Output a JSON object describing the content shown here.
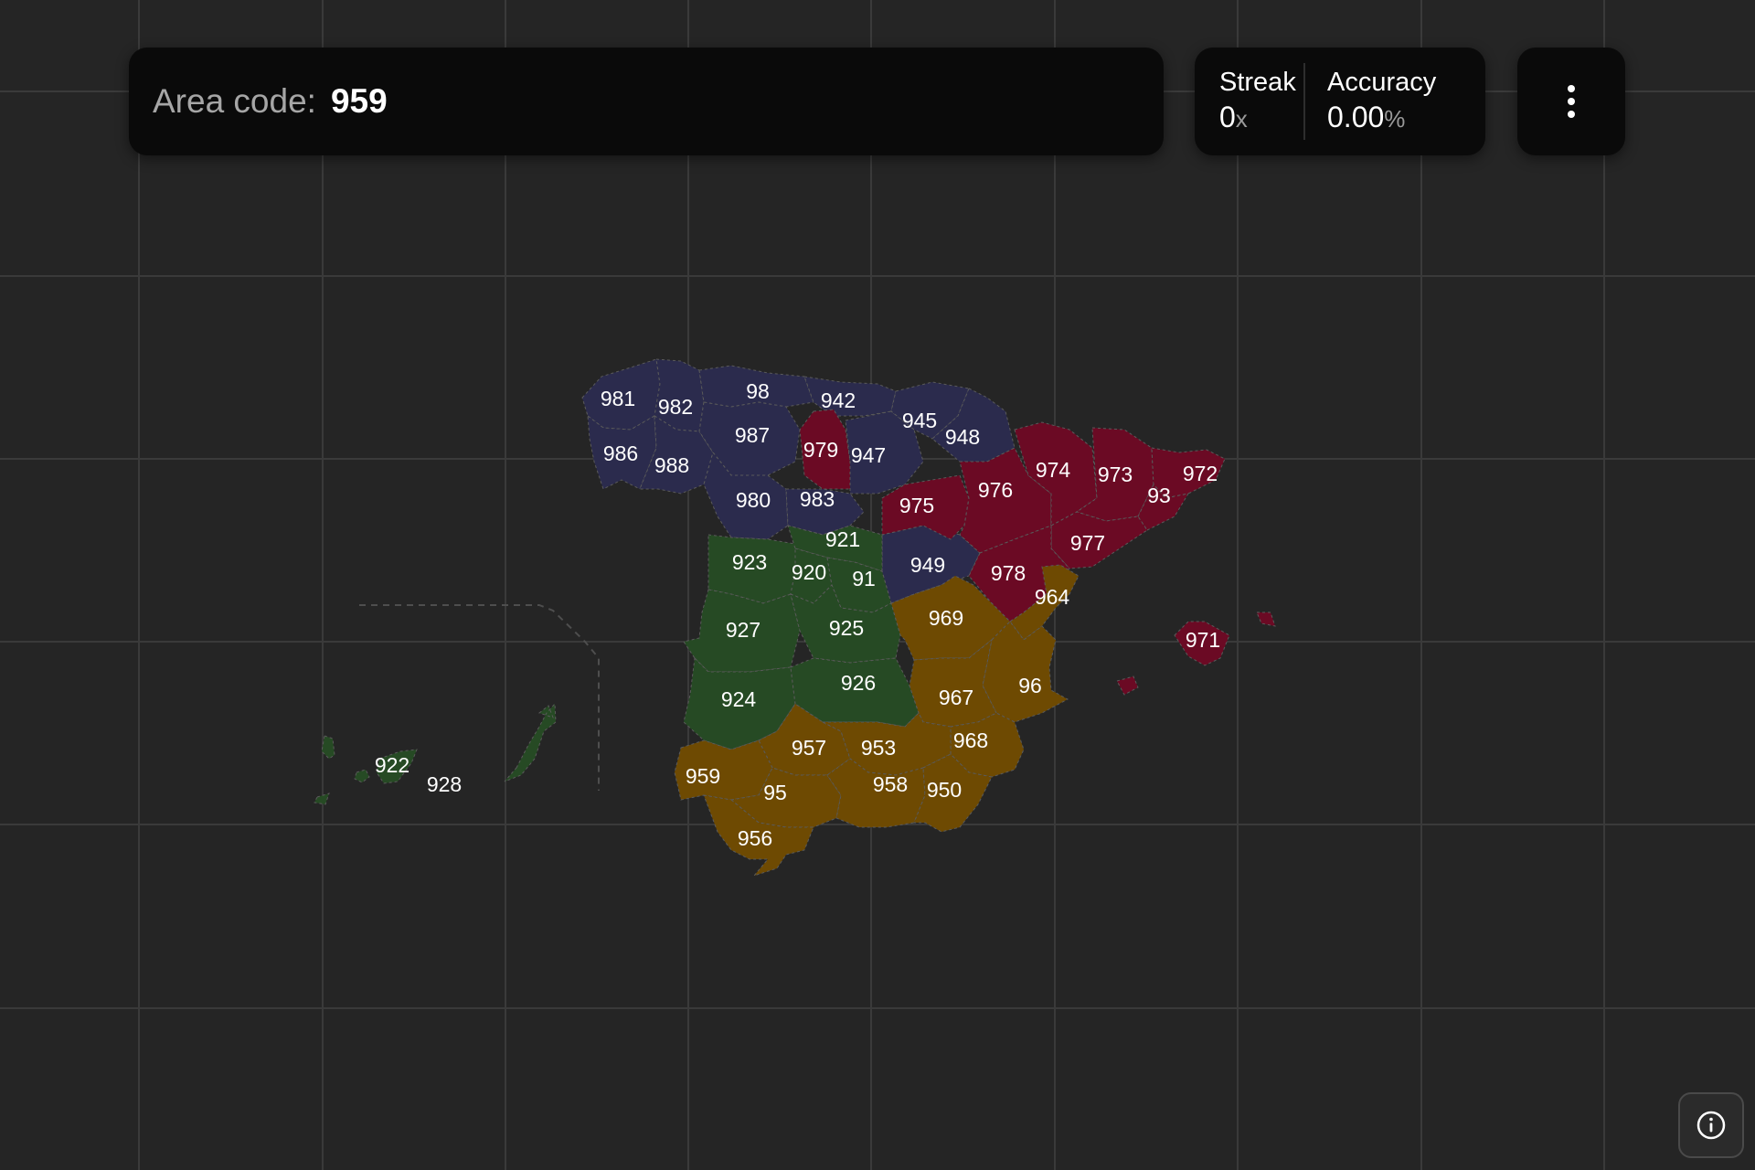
{
  "header": {
    "prompt_label": "Area code:",
    "prompt_value": "959"
  },
  "stats": {
    "streak_title": "Streak",
    "streak_value": "0",
    "streak_unit": "x",
    "accuracy_title": "Accuracy",
    "accuracy_value": "0.00",
    "accuracy_unit": "%"
  },
  "icons": {
    "menu": "vertical-ellipsis-icon",
    "info": "info-circle-icon"
  },
  "colors": {
    "background": "#252525",
    "panel": "#0a0a0a",
    "north_west": "#2b2b4d",
    "north_east": "#6b0a24",
    "center_west": "#264a24",
    "south_east": "#6e4a02"
  },
  "map": {
    "regions": [
      "981",
      "982",
      "98",
      "942",
      "945",
      "948",
      "986",
      "988",
      "987",
      "979",
      "947",
      "980",
      "983",
      "975",
      "976",
      "974",
      "973",
      "93",
      "972",
      "977",
      "921",
      "923",
      "920",
      "91",
      "949",
      "978",
      "964",
      "927",
      "925",
      "969",
      "971",
      "924",
      "926",
      "967",
      "96",
      "968",
      "957",
      "953",
      "959",
      "95",
      "958",
      "950",
      "956",
      "922",
      "928"
    ]
  }
}
